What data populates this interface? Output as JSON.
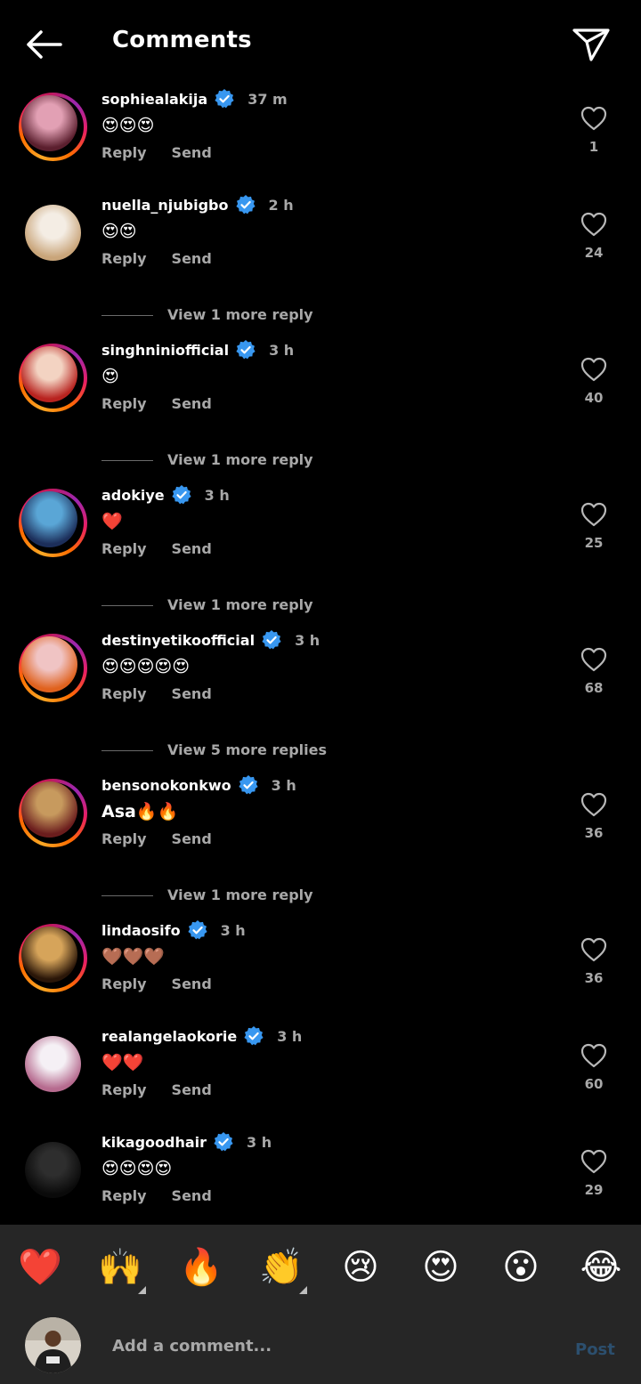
{
  "header": {
    "title": "Comments",
    "back_icon": "back-arrow-icon",
    "share_icon": "send-icon"
  },
  "comments": [
    {
      "username": "sophiealakija",
      "time": "37 m",
      "text": "😍😍😍",
      "likes": "1",
      "ring": true,
      "avatar_colors": [
        "#e2a0b4",
        "#5b1f2e"
      ]
    },
    {
      "username": "nuella_njubigbo",
      "time": "2 h",
      "text": "😍😍",
      "likes": "24",
      "ring": false,
      "avatar_colors": [
        "#f4ede4",
        "#c9a57a"
      ],
      "more_replies": "View 1 more reply"
    },
    {
      "username": "singhniniofficial",
      "time": "3 h",
      "text": "😍",
      "likes": "40",
      "ring": true,
      "avatar_colors": [
        "#f3d3c2",
        "#b8231f"
      ],
      "more_replies": "View 1 more reply"
    },
    {
      "username": "adokiye",
      "time": "3 h",
      "text": "❤️",
      "likes": "25",
      "ring": true,
      "avatar_colors": [
        "#5aa6d6",
        "#1c2e5a"
      ],
      "more_replies": "View 1 more reply"
    },
    {
      "username": "destinyetikoofficial",
      "time": "3 h",
      "text": "😍😍😍😍😍",
      "likes": "68",
      "ring": true,
      "avatar_colors": [
        "#f0c4c4",
        "#e0621e"
      ],
      "more_replies": "View 5 more replies"
    },
    {
      "username": "bensonokonkwo",
      "time": "3 h",
      "text": "Asa🔥🔥",
      "likes": "36",
      "ring": true,
      "avatar_colors": [
        "#c79a5e",
        "#6b1d1d"
      ],
      "more_replies": "View 1 more reply"
    },
    {
      "username": "lindaosifo",
      "time": "3 h",
      "text": "🤎🤎🤎",
      "likes": "36",
      "ring": true,
      "avatar_colors": [
        "#d6a45a",
        "#2a1608"
      ]
    },
    {
      "username": "realangelaokorie",
      "time": "3 h",
      "text": "❤️❤️",
      "likes": "60",
      "ring": false,
      "avatar_colors": [
        "#f5f0f5",
        "#b66b8f"
      ]
    },
    {
      "username": "kikagoodhair",
      "time": "3 h",
      "text": "😍😍😍😍",
      "likes": "29",
      "ring": false,
      "avatar_colors": [
        "#2e2e2e",
        "#0a0a0a"
      ]
    }
  ],
  "actions": {
    "reply": "Reply",
    "send": "Send"
  },
  "quick_emojis": [
    "❤️",
    "🙌",
    "🔥",
    "👏",
    "😢",
    "😍",
    "😮",
    "😂"
  ],
  "composer": {
    "placeholder": "Add a comment...",
    "post_label": "Post"
  },
  "colors": {
    "background": "#000000",
    "muted_text": "#a8a8a8",
    "verified": "#3897f0",
    "post_disabled": "#2c4f6e",
    "bar": "#262626"
  }
}
